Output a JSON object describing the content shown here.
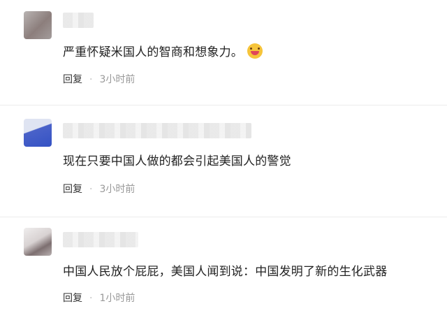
{
  "comments": [
    {
      "text": "严重怀疑米国人的智商和想象力。",
      "emoji": "grinning-face-emoji",
      "reply_label": "回复",
      "separator": "·",
      "time": "3小时前"
    },
    {
      "text": "现在只要中国人做的都会引起美国人的警觉",
      "reply_label": "回复",
      "separator": "·",
      "time": "3小时前"
    },
    {
      "text": "中国人民放个屁屁，美国人闻到说：中国发明了新的生化武器",
      "reply_label": "回复",
      "separator": "·",
      "time": "1小时前"
    }
  ]
}
